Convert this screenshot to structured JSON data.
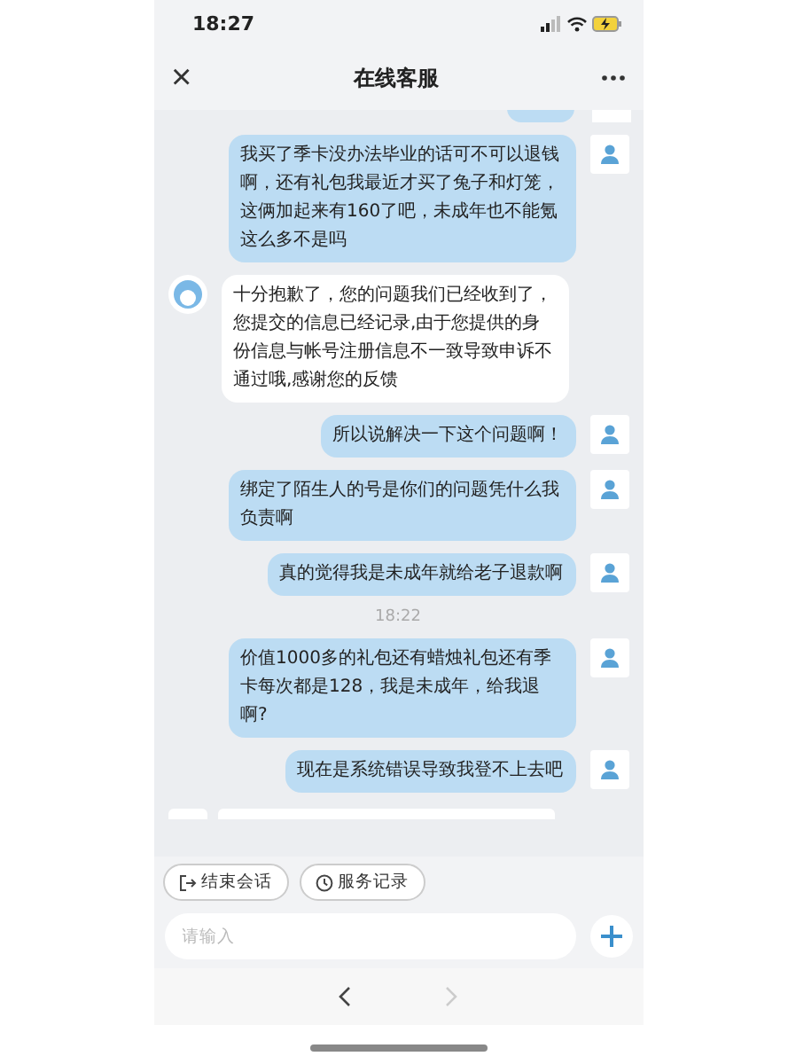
{
  "status_bar": {
    "time": "18:27"
  },
  "header": {
    "title": "在线客服",
    "close_icon": "×"
  },
  "messages": [
    {
      "kind": "message",
      "outgoing": true,
      "text": "我买了季卡没办法毕业的话可不可以退钱啊，还有礼包我最近才买了兔子和灯笼，这俩加起来有160了吧，未成年也不能氪这么多不是吗"
    },
    {
      "kind": "message",
      "outgoing": false,
      "text": "十分抱歉了，您的问题我们已经收到了，您提交的信息已经记录,由于您提供的身份信息与帐号注册信息不一致导致申诉不通过哦,感谢您的反馈"
    },
    {
      "kind": "message",
      "outgoing": true,
      "text": "所以说解决一下这个问题啊！"
    },
    {
      "kind": "message",
      "outgoing": true,
      "text": "绑定了陌生人的号是你们的问题凭什么我负责啊"
    },
    {
      "kind": "message",
      "outgoing": true,
      "text": "真的觉得我是未成年就给老子退款啊"
    },
    {
      "kind": "time",
      "text": "18:22"
    },
    {
      "kind": "message",
      "outgoing": true,
      "text": "价值1000多的礼包还有蜡烛礼包还有季卡每次都是128，我是未成年，给我退啊?"
    },
    {
      "kind": "message",
      "outgoing": true,
      "text": "现在是系统错误导致我登不上去吧"
    }
  ],
  "quick_actions": [
    {
      "kind": "exit",
      "label": "结束会话"
    },
    {
      "kind": "history",
      "label": "服务记录"
    }
  ],
  "input": {
    "placeholder": "请输入"
  },
  "browser_nav": [
    {
      "kind": "back",
      "disabled": false
    },
    {
      "kind": "forward",
      "disabled": true
    }
  ]
}
